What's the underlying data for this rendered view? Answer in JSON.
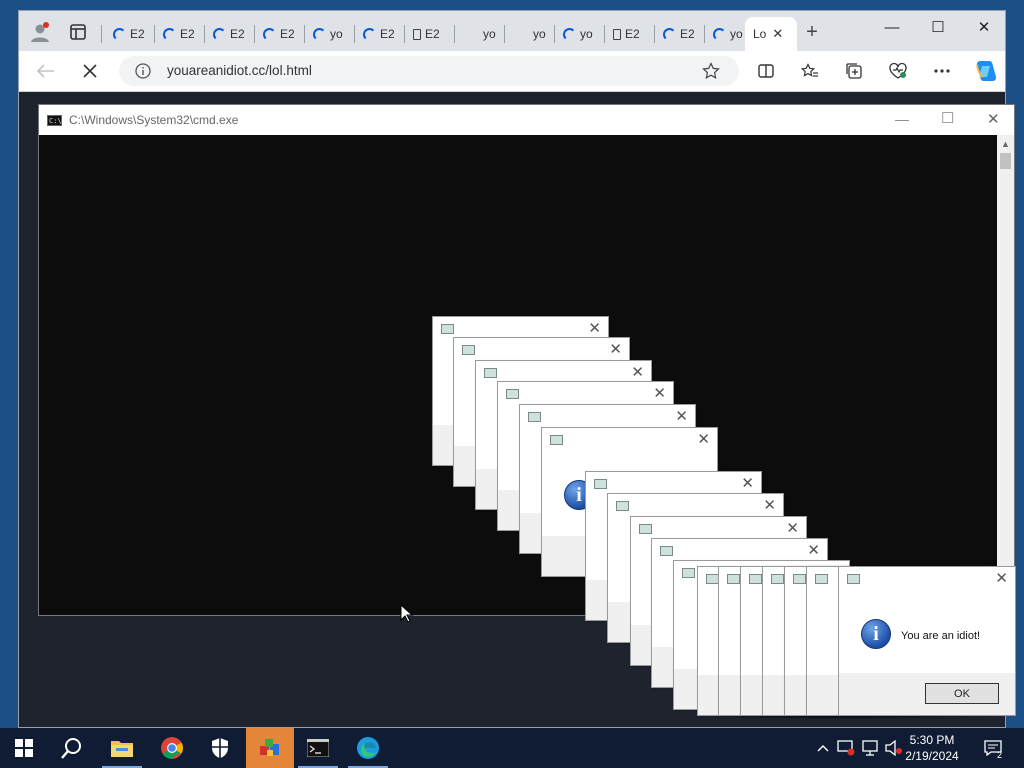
{
  "browser": {
    "tabs": [
      {
        "title": "",
        "kind": "profile"
      },
      {
        "title": "",
        "kind": "workspaces"
      },
      {
        "title": "E2",
        "kind": "loading"
      },
      {
        "title": "E2",
        "kind": "loading"
      },
      {
        "title": "E2",
        "kind": "loading"
      },
      {
        "title": "E2",
        "kind": "loading"
      },
      {
        "title": "yo",
        "kind": "loading"
      },
      {
        "title": "E2",
        "kind": "loading"
      },
      {
        "title": "E2",
        "kind": "doc"
      },
      {
        "title": "yo",
        "kind": "blank"
      },
      {
        "title": "yo",
        "kind": "blank"
      },
      {
        "title": "yo",
        "kind": "loading"
      },
      {
        "title": "E2",
        "kind": "doc"
      },
      {
        "title": "E2",
        "kind": "loading"
      },
      {
        "title": "yo",
        "kind": "loading"
      },
      {
        "title": "Lo",
        "kind": "active"
      }
    ],
    "new_tab_symbol": "+",
    "window_controls": {
      "minimize": "—",
      "maximize": "☐",
      "close": "✕"
    },
    "url": "youareanidiot.cc/lol.html",
    "back_icon": "back-arrow-icon",
    "stop_icon": "stop-icon"
  },
  "cmd": {
    "title": "C:\\Windows\\System32\\cmd.exe",
    "icon_text": "C:\\"
  },
  "dialog": {
    "message": "You are an idiot!",
    "ok_label": "OK",
    "info_glyph": "i"
  },
  "taskbar": {
    "time": "5:30 PM",
    "date": "2/19/2024",
    "colors": {
      "bar": "#0f1c33",
      "active": "#e3863a"
    }
  }
}
